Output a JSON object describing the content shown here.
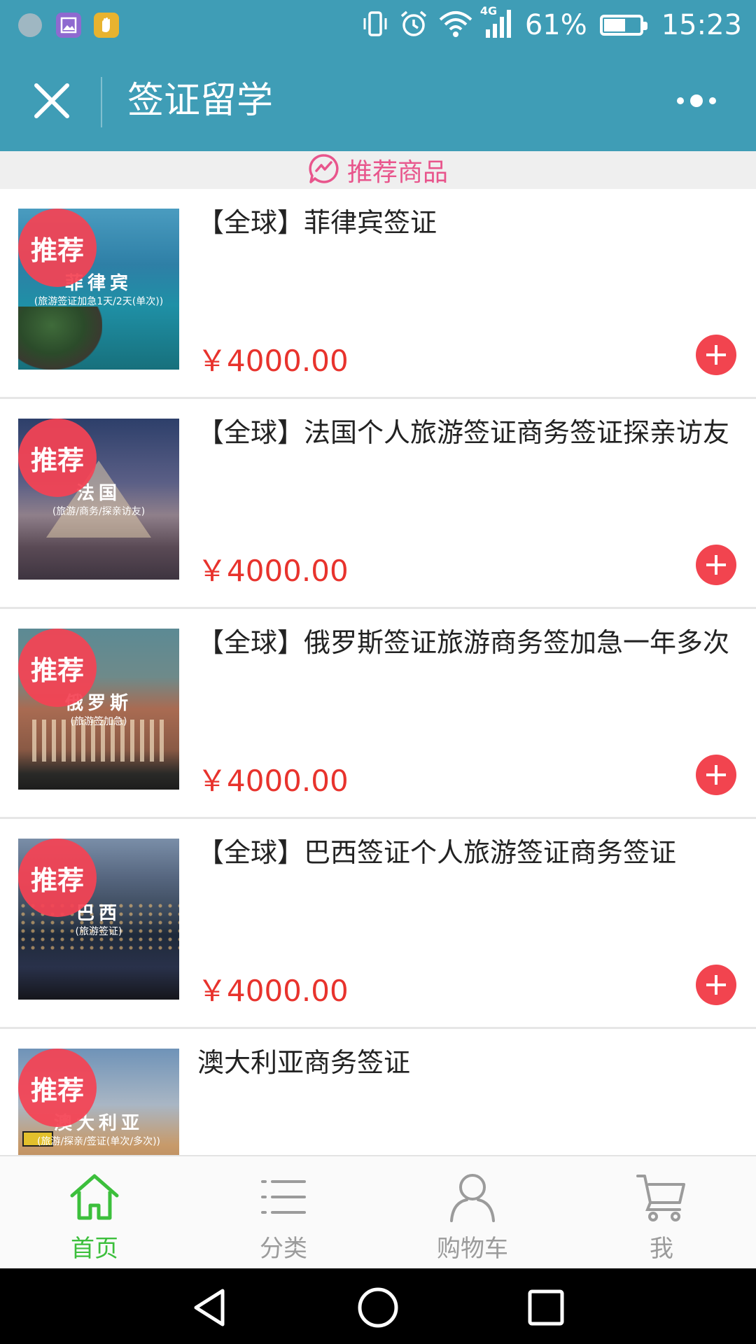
{
  "status_bar": {
    "network": "4G",
    "battery_percent": "61%",
    "battery_level": 0.61,
    "time": "15:23",
    "left_icons": [
      "app-icon",
      "gallery-icon",
      "hand-icon"
    ],
    "right_icons": [
      "vibrate-icon",
      "alarm-icon",
      "wifi-icon",
      "signal-icon",
      "battery-icon"
    ]
  },
  "header": {
    "title": "签证留学",
    "close_icon": "close-icon",
    "more_icon": "more-icon",
    "bg_color": "#3f9db6"
  },
  "section": {
    "title": "推荐商品",
    "icon": "trend-chat-icon",
    "color": "#e8558c"
  },
  "products": [
    {
      "title": "【全球】菲律宾签证",
      "price": "￥4000.00",
      "badge": "推荐",
      "thumb_name": "菲律宾",
      "thumb_sub": "(旅游签证加急1天/2天(单次))"
    },
    {
      "title": "【全球】法国个人旅游签证商务签证探亲访友",
      "price": "￥4000.00",
      "badge": "推荐",
      "thumb_name": "法国",
      "thumb_sub": "(旅游/商务/探亲访友)"
    },
    {
      "title": "【全球】俄罗斯签证旅游商务签加急一年多次",
      "price": "￥4000.00",
      "badge": "推荐",
      "thumb_name": "俄罗斯",
      "thumb_sub": "(旅游签加急)"
    },
    {
      "title": "【全球】巴西签证个人旅游签证商务签证",
      "price": "￥4000.00",
      "badge": "推荐",
      "thumb_name": "巴西",
      "thumb_sub": "(旅游签证)"
    },
    {
      "title": "澳大利亚商务签证",
      "price": "",
      "badge": "推荐",
      "thumb_name": "澳大利亚",
      "thumb_sub": "(旅游/探亲/签证(单次/多次))"
    }
  ],
  "tab_bar": {
    "tabs": [
      {
        "label": "首页",
        "icon": "home-icon",
        "active": true
      },
      {
        "label": "分类",
        "icon": "list-icon",
        "active": false
      },
      {
        "label": "购物车",
        "icon": "user-icon",
        "active": false
      },
      {
        "label": "我",
        "icon": "cart-icon",
        "active": false
      }
    ],
    "active_color": "#3cbf3c",
    "inactive_color": "#9b9b9b"
  },
  "nav_bar": {
    "buttons": [
      "back-icon",
      "home-circle-icon",
      "recents-icon"
    ]
  },
  "colors": {
    "price": "#e8332d",
    "badge": "#f44354",
    "add_button": "#f2444f"
  }
}
